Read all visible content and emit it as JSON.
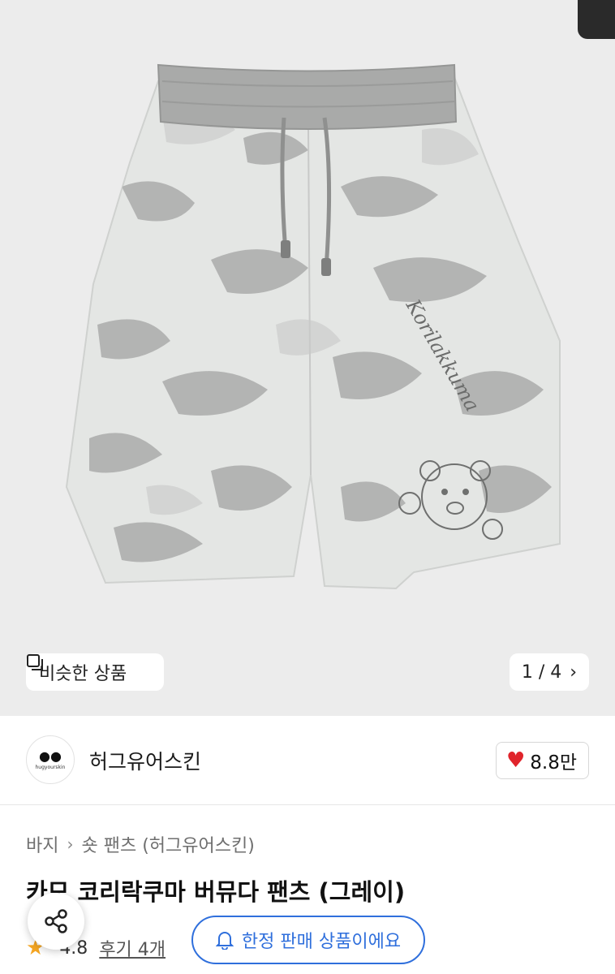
{
  "gallery": {
    "similar_label": "비슷한 상품",
    "pager_text": "1 / 4",
    "print_text": "Korilakkuma"
  },
  "brand": {
    "logo_text": "hugyourskin",
    "name": "허그유어스킨",
    "like_count": "8.8만"
  },
  "breadcrumb": [
    "바지",
    "숏 팬츠 (허그유어스킨)"
  ],
  "product": {
    "title": "카모 코리락쿠마 버뮤다 팬츠 (그레이)",
    "rating": "4.8",
    "reviews": "후기 4개"
  },
  "notice": {
    "limited_label": "한정 판매 상품이에요"
  },
  "colors": {
    "accent_blue": "#2f6fdc",
    "heart_red": "#e0242b",
    "star_orange": "#f5a623"
  },
  "icons": [
    "similar-items-icon",
    "chevron-right-icon",
    "heart-icon",
    "share-icon",
    "bell-icon",
    "star-icon"
  ]
}
